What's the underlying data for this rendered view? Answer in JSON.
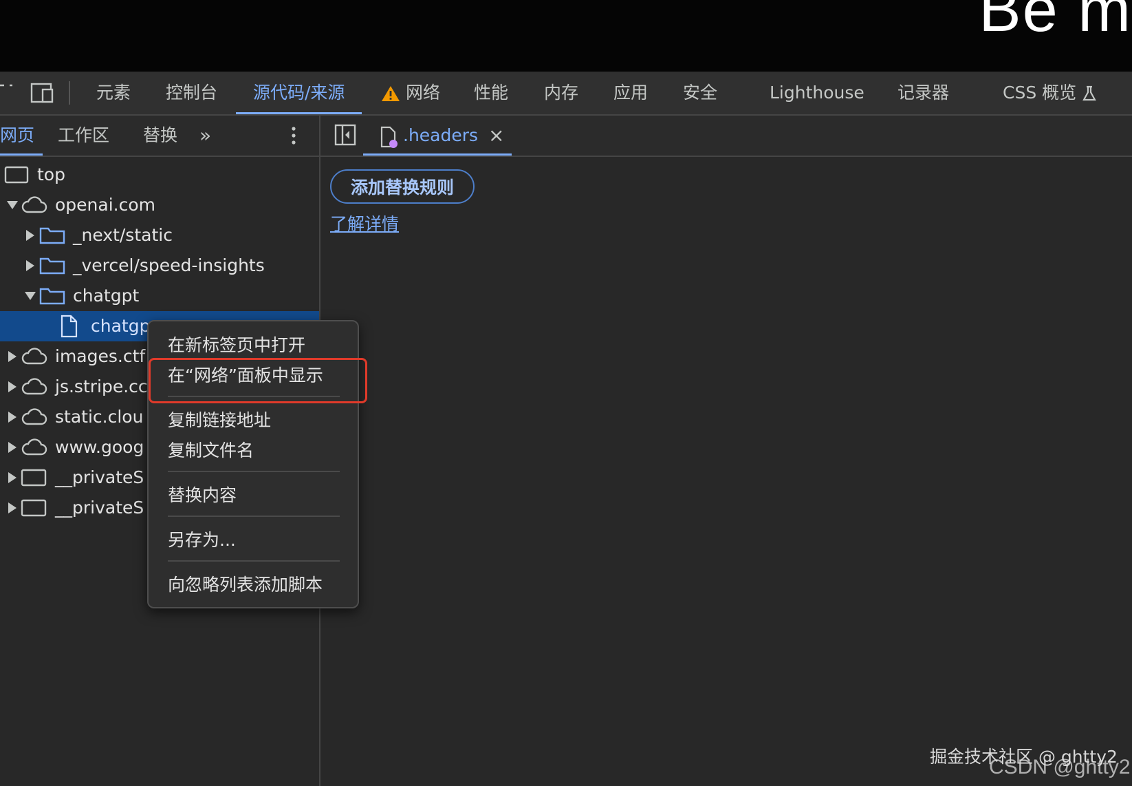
{
  "header_text": "Be m",
  "tabs": [
    {
      "label": "元素"
    },
    {
      "label": "控制台"
    },
    {
      "label": "源代码/来源",
      "active": true
    },
    {
      "label": "网络",
      "warning": true
    },
    {
      "label": "性能"
    },
    {
      "label": "内存"
    },
    {
      "label": "应用"
    },
    {
      "label": "安全"
    },
    {
      "label": "Lighthouse"
    },
    {
      "label": "记录器"
    },
    {
      "label": "CSS 概览"
    }
  ],
  "subtabs": {
    "page": "网页",
    "workspace": "工作区",
    "overrides": "替换",
    "more": "»"
  },
  "editor_tab": {
    "label": ".headers",
    "close": "×"
  },
  "tree": [
    {
      "label": "top",
      "icon": "frame-icon",
      "level": 0
    },
    {
      "label": "openai.com",
      "icon": "cloud-icon",
      "level": 0,
      "expanded": true
    },
    {
      "label": "_next/static",
      "icon": "folder-icon",
      "level": 1,
      "expanded": false
    },
    {
      "label": "_vercel/speed-insights",
      "icon": "folder-icon",
      "level": 1,
      "expanded": false
    },
    {
      "label": "chatgpt",
      "icon": "folder-icon",
      "level": 1,
      "expanded": true
    },
    {
      "label": "chatgp",
      "icon": "file-icon",
      "level": 2,
      "selected": true
    },
    {
      "label": "images.ctf",
      "icon": "cloud-icon",
      "level": 0,
      "expanded": false
    },
    {
      "label": "js.stripe.cc",
      "icon": "cloud-icon",
      "level": 0,
      "expanded": false
    },
    {
      "label": "static.clou",
      "icon": "cloud-icon",
      "level": 0,
      "expanded": false
    },
    {
      "label": "www.goog",
      "icon": "cloud-icon",
      "level": 0,
      "expanded": false
    },
    {
      "label": "__privateS",
      "icon": "frame-icon",
      "level": 0,
      "expanded": false
    },
    {
      "label": "__privateS",
      "icon": "frame-icon",
      "level": 0,
      "expanded": false
    }
  ],
  "overrides_panel": {
    "add_rule": "添加替换规则",
    "learn_more": "了解详情"
  },
  "context_menu": {
    "items": [
      "在新标签页中打开",
      "在“网络”面板中显示",
      "复制链接地址",
      "复制文件名",
      "替换内容",
      "另存为...",
      "向忽略列表添加脚本"
    ],
    "highlight_color": "#e03a2a"
  },
  "watermarks": {
    "juejin": "掘金技术社区 @ ghtty2",
    "csdn": "CSDN @ghtty2"
  },
  "colors": {
    "accent": "#7cacf8",
    "selection": "#124a8c",
    "warning": "#f29900"
  }
}
